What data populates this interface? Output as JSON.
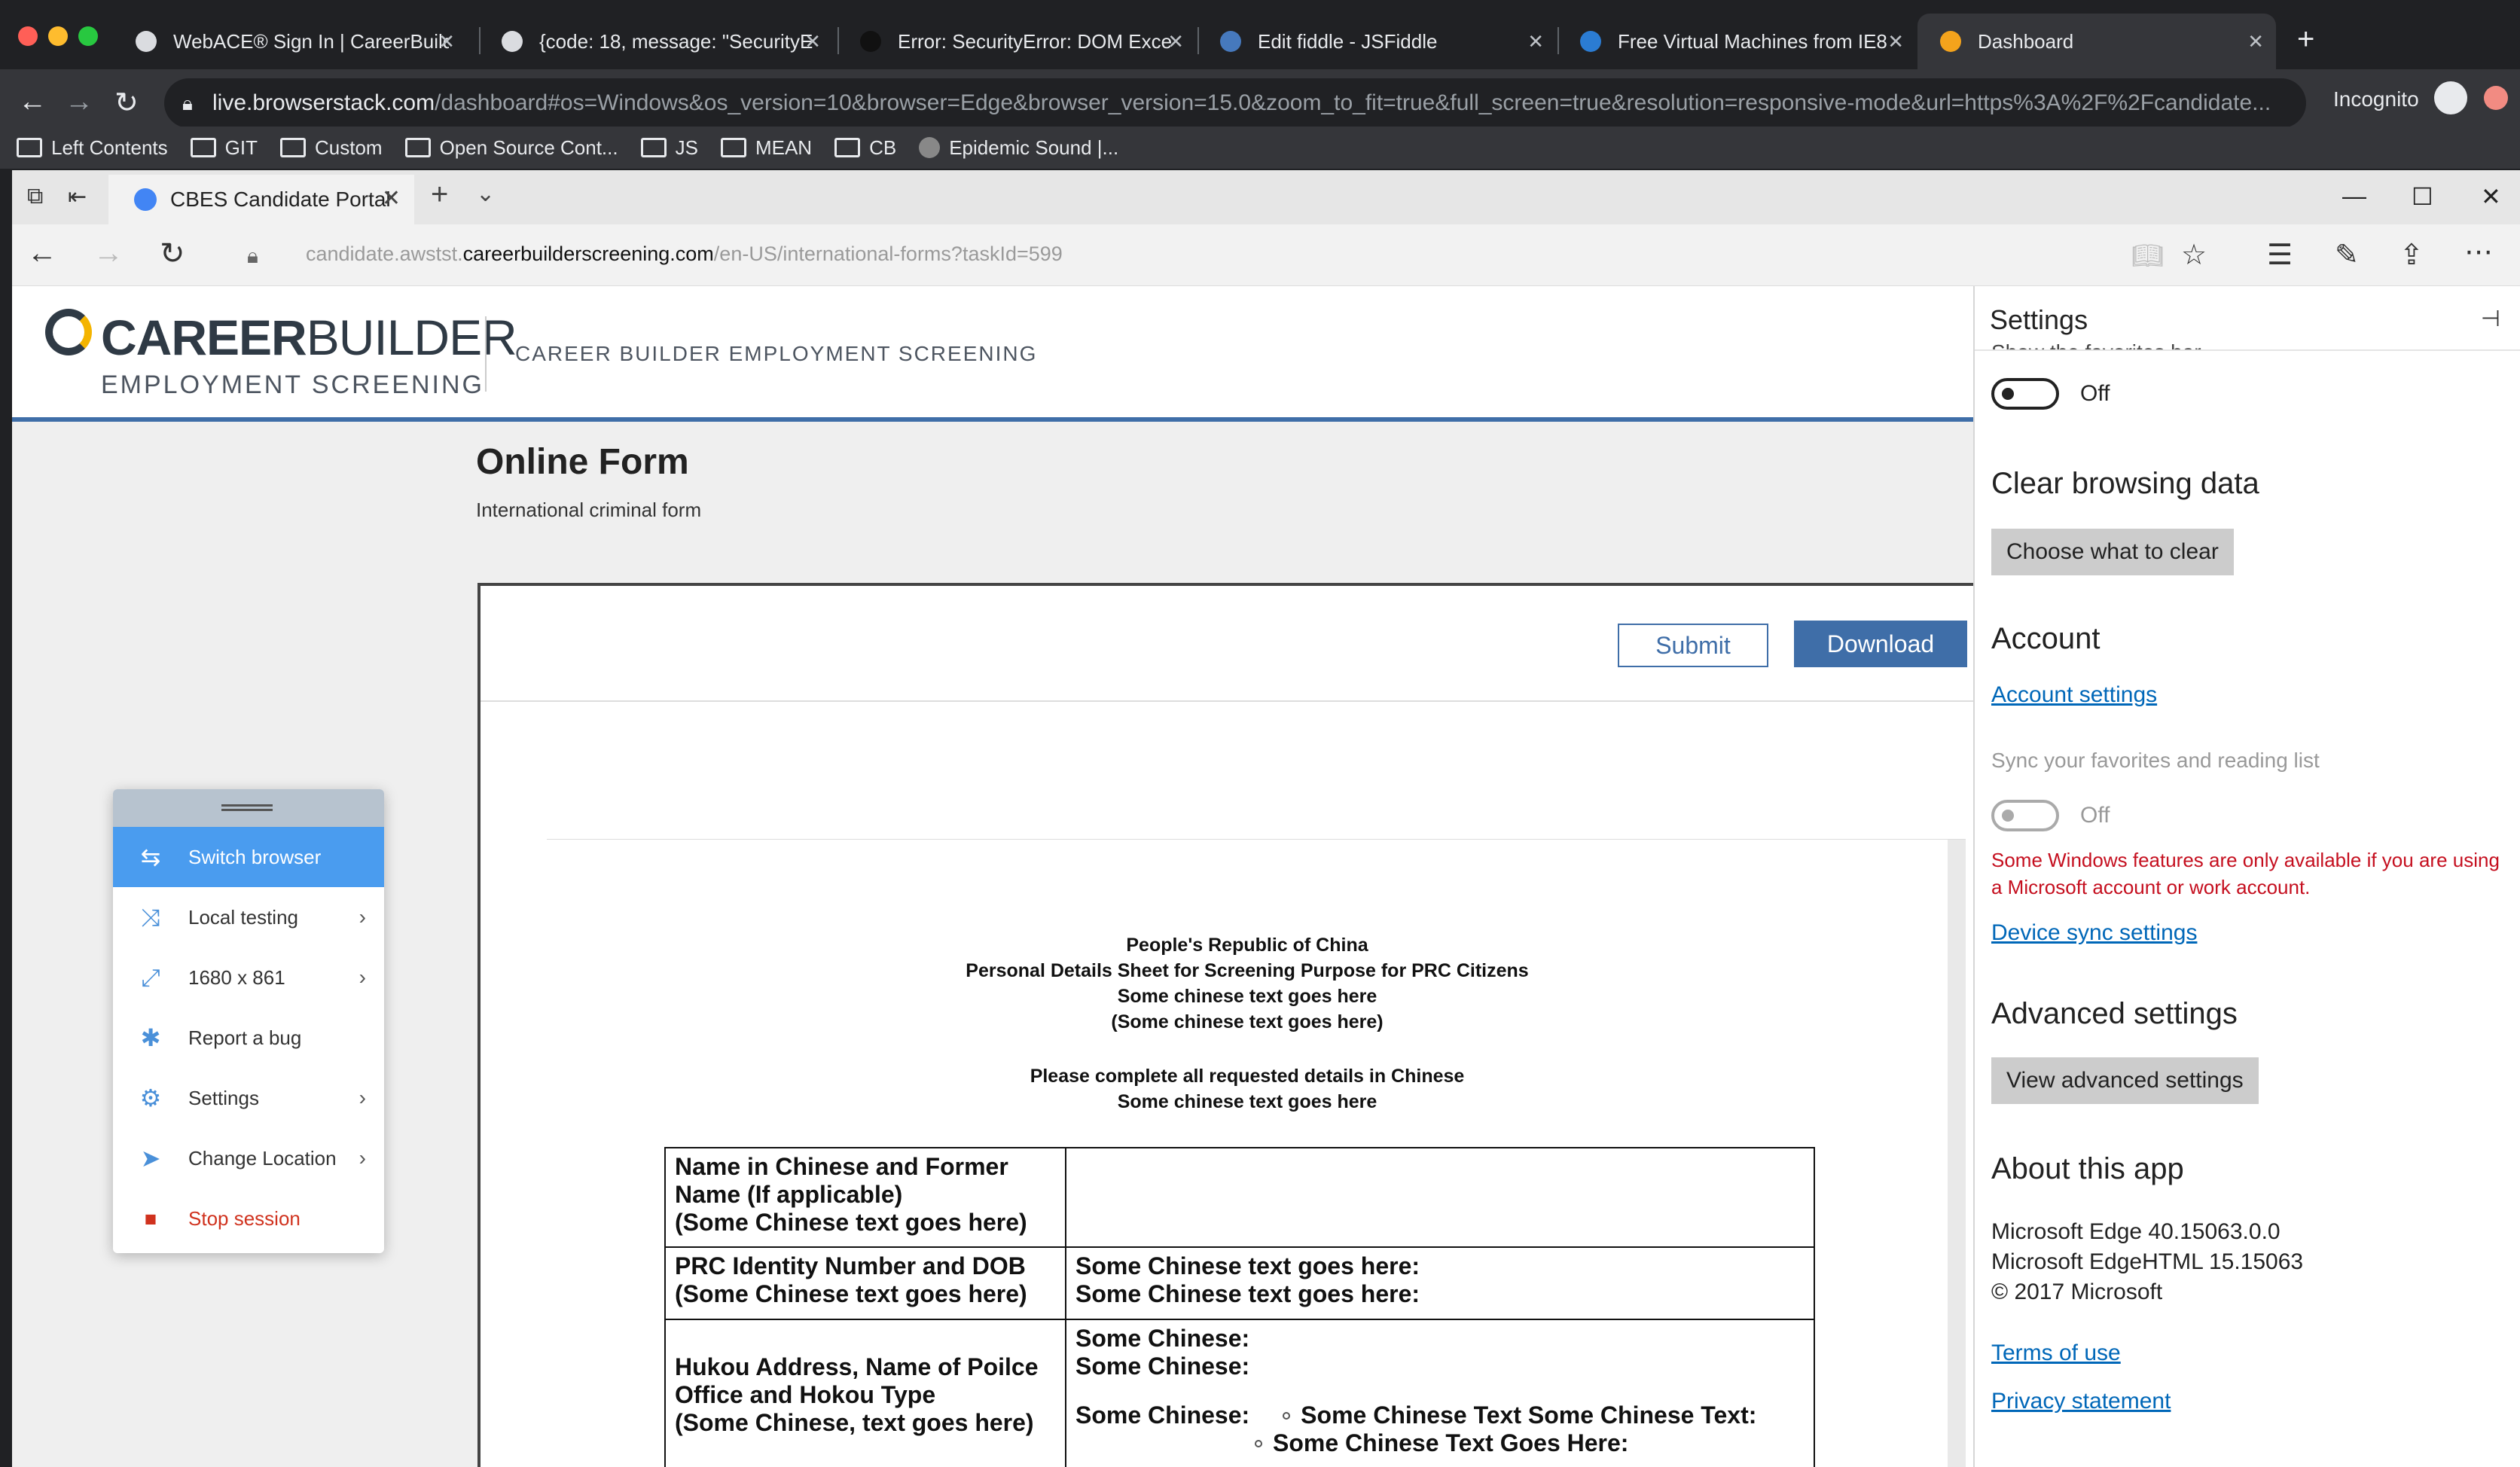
{
  "chrome": {
    "tabs": [
      {
        "label": "WebACE® Sign In | CareerBuild"
      },
      {
        "label": "{code: 18, message: \"SecurityE"
      },
      {
        "label": "Error: SecurityError: DOM Exce"
      },
      {
        "label": "Edit fiddle - JSFiddle"
      },
      {
        "label": "Free Virtual Machines from IE8"
      },
      {
        "label": "Dashboard"
      }
    ],
    "url_host": "live.browserstack.com",
    "url_rest": "/dashboard#os=Windows&os_version=10&browser=Edge&browser_version=15.0&zoom_to_fit=true&full_screen=true&resolution=responsive-mode&url=https%3A%2F%2Fcandidate...",
    "profile_label": "Incognito",
    "bookmarks": [
      "Left Contents",
      "GIT",
      "Custom",
      "Open Source Cont...",
      "JS",
      "MEAN",
      "CB",
      "Epidemic Sound |..."
    ]
  },
  "edge": {
    "tab_label": "CBES Candidate Portal",
    "url_prefix": "candidate.awstst.",
    "url_host": "careerbuilderscreening.com",
    "url_path": "/en-US/international-forms?taskId=599"
  },
  "site": {
    "logo_bold": "CAREER",
    "logo_light": "BUILDER",
    "logo_sub": "EMPLOYMENT SCREENING",
    "header_title": "CAREER BUILDER EMPLOYMENT SCREENING",
    "page_title": "Online Form",
    "page_subtitle": "International criminal form",
    "submit_label": "Submit",
    "download_label": "Download"
  },
  "document": {
    "heading_lines": [
      "People's Republic of China",
      "Personal Details Sheet for Screening Purpose for PRC Citizens",
      "Some chinese text goes here",
      "(Some chinese text goes here)"
    ],
    "instruction_lines": [
      "Please complete all requested details in Chinese",
      "Some chinese text goes here"
    ],
    "rows": [
      {
        "label_lines": [
          "Name in Chinese and Former",
          "Name (If applicable)",
          "(Some Chinese text goes here)"
        ]
      },
      {
        "label_lines": [
          "PRC Identity Number and DOB",
          "(Some Chinese text goes here)"
        ],
        "value_lines": [
          "Some Chinese text goes here:",
          "Some Chinese text goes here:"
        ]
      },
      {
        "label_lines": [
          "Hukou Address, Name of Poilce",
          "Office and Hokou Type",
          "(Some Chinese, text goes here)"
        ],
        "value_lines": [
          "Some Chinese:",
          "Some Chinese:"
        ],
        "value_sub_label": "Some Chinese:",
        "bullets": [
          "Some Chinese Text Some Chinese Text:",
          "Some Chinese Text Goes Here:"
        ]
      }
    ]
  },
  "bs_menu": {
    "items": [
      {
        "label": "Switch browser"
      },
      {
        "label": "Local testing"
      },
      {
        "label": "1680 x 861"
      },
      {
        "label": "Report a bug"
      },
      {
        "label": "Settings"
      },
      {
        "label": "Change Location"
      },
      {
        "label": "Stop session"
      }
    ]
  },
  "settings": {
    "title": "Settings",
    "cut_text": "Show the favorites bar",
    "favorites_toggle_state": "Off",
    "clear_heading": "Clear browsing data",
    "clear_button": "Choose what to clear",
    "account_heading": "Account",
    "account_link": "Account settings",
    "sync_label": "Sync your favorites and reading list",
    "sync_toggle_state": "Off",
    "sync_warning": "Some Windows features are only available if you are using a Microsoft account or work account.",
    "device_sync_link": "Device sync settings",
    "advanced_heading": "Advanced settings",
    "advanced_button": "View advanced settings",
    "about_heading": "About this app",
    "about_lines": [
      "Microsoft Edge 40.15063.0.0",
      "Microsoft EdgeHTML 15.15063",
      "© 2017 Microsoft"
    ],
    "terms_link": "Terms of use",
    "privacy_link": "Privacy statement"
  },
  "colors": {
    "chrome_bg": "#202124",
    "bs_active": "#4a9cef",
    "brand_blue": "#3f6ea8",
    "stop_red": "#d0321e",
    "link_blue": "#0067b8"
  }
}
